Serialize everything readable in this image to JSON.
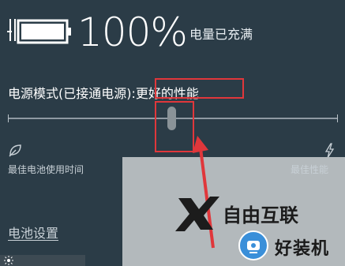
{
  "battery": {
    "percent": "100%",
    "status": "电量已充满",
    "level": 1.0
  },
  "power_mode": {
    "label": "电源模式(已接通电源):",
    "value": "更好的性能",
    "slider_level": 0.5,
    "left_label": "最佳电池使用时间",
    "right_label": "最佳性能"
  },
  "battery_settings_link": "电池设置",
  "watermarks": {
    "center": "自由互联",
    "logo_text": "好装机"
  },
  "colors": {
    "background": "#2b3c47",
    "annotation_red": "#e0373b",
    "overlay_gray": "#b3b9bc"
  },
  "icons": [
    "battery-full-icon",
    "leaf-icon",
    "bolt-icon",
    "sun-icon"
  ]
}
